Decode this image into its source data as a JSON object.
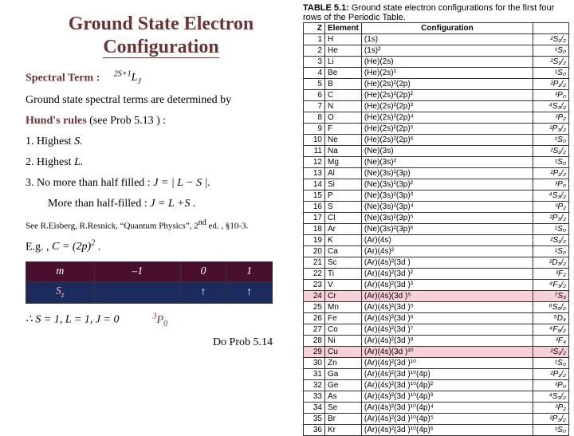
{
  "title_l1": "Ground State Electron",
  "title_l2": "Configuration",
  "spectral_label": "Spectral Term :",
  "spectral_formula_sup": "2S+1",
  "spectral_formula_base": "L",
  "spectral_formula_sub": "J",
  "gs_line": "Ground state spectral terms are determined by",
  "hund": "Hund's rules",
  "hund_after": "  (see Prob 5.13 ) :",
  "r1": "1.   Highest ",
  "r1i": "S.",
  "r2": "2.   Highest ",
  "r2i": "L.",
  "r3": "3.   No more than half filled : ",
  "r3f": "J = |  L  − S  |.",
  "r3b": "More than half-filled :  ",
  "r3bf": "J =   L +S .",
  "ref": "See R.Eisberg, R.Resnick, “Quantum Physics”, 2",
  "ref_nd": "nd",
  "ref_after": " ed. , §10-3.",
  "eg": "E.g. ,  ",
  "egf": "C = (2p)",
  "eg_sup": "2",
  "eg_dot": " .",
  "etbl": {
    "h": [
      "m",
      "–1",
      "0",
      "1"
    ],
    "rlabel": "S",
    "rsub": "z",
    "c": [
      "",
      "↑",
      "↑"
    ]
  },
  "concl": "∴  S = 1,  L = 1, J = 0",
  "term3p0_sup": "3",
  "term3p0_base": "P",
  "term3p0_sub": "0",
  "doprob": "Do Prob 5.14",
  "caption_pre": "TABLE 5.1: ",
  "caption": "Ground state electron configurations for the first four rows of the Periodic Table.",
  "ptbl": {
    "head": [
      "Z",
      "Element",
      "Configuration",
      ""
    ],
    "rows": [
      {
        "z": "1",
        "el": "H",
        "cfg": "(1s)",
        "term": "²S₁/₂"
      },
      {
        "z": "2",
        "el": "He",
        "cfg": "(1s)²",
        "term": "¹S₀"
      },
      {
        "z": "3",
        "el": "Li",
        "cfg": "(He)(2s)",
        "term": "²S₁/₂"
      },
      {
        "z": "4",
        "el": "Be",
        "cfg": "(He)(2s)²",
        "term": "¹S₀"
      },
      {
        "z": "5",
        "el": "B",
        "cfg": "(He)(2s)²(2p)",
        "term": "²P₁/₂"
      },
      {
        "z": "6",
        "el": "C",
        "cfg": "(He)(2s)²(2p)²",
        "term": "³P₀"
      },
      {
        "z": "7",
        "el": "N",
        "cfg": "(He)(2s)²(2p)³",
        "term": "⁴S₃/₂"
      },
      {
        "z": "8",
        "el": "O",
        "cfg": "(He)(2s)²(2p)⁴",
        "term": "³P₂"
      },
      {
        "z": "9",
        "el": "F",
        "cfg": "(He)(2s)²(2p)⁵",
        "term": "²P₃/₂"
      },
      {
        "z": "10",
        "el": "Ne",
        "cfg": "(He)(2s)²(2p)⁶",
        "term": "¹S₀"
      },
      {
        "z": "11",
        "el": "Na",
        "cfg": "(Ne)(3s)",
        "term": "²S₁/₂"
      },
      {
        "z": "12",
        "el": "Mg",
        "cfg": "(Ne)(3s)²",
        "term": "¹S₀"
      },
      {
        "z": "13",
        "el": "Al",
        "cfg": "(Ne)(3s)²(3p)",
        "term": "²P₁/₂"
      },
      {
        "z": "14",
        "el": "Si",
        "cfg": "(Ne)(3s)²(3p)²",
        "term": "³P₀"
      },
      {
        "z": "15",
        "el": "P",
        "cfg": "(Ne)(3s)²(3p)³",
        "term": "⁴S₃/₂"
      },
      {
        "z": "16",
        "el": "S",
        "cfg": "(Ne)(3s)²(3p)⁴",
        "term": "³P₂"
      },
      {
        "z": "17",
        "el": "Cl",
        "cfg": "(Ne)(3s)²(3p)⁵",
        "term": "²P₃/₂"
      },
      {
        "z": "18",
        "el": "Ar",
        "cfg": "(Ne)(3s)²(3p)⁶",
        "term": "¹S₀"
      },
      {
        "z": "19",
        "el": "K",
        "cfg": "(Ar)(4s)",
        "term": "²S₁/₂"
      },
      {
        "z": "20",
        "el": "Ca",
        "cfg": "(Ar)(4s)²",
        "term": "¹S₀"
      },
      {
        "z": "21",
        "el": "Sc",
        "cfg": "(Ar)(4s)²(3d  )",
        "term": "²D₃/₂"
      },
      {
        "z": "22",
        "el": "Ti",
        "cfg": "(Ar)(4s)²(3d  )²",
        "term": "³F₂"
      },
      {
        "z": "23",
        "el": "V",
        "cfg": "(Ar)(4s)²(3d  )³",
        "term": "⁴F₃/₂"
      },
      {
        "z": "24",
        "el": "Cr",
        "cfg": "(Ar)(4s)(3d  )⁵",
        "term": "⁷S₃",
        "hl": true
      },
      {
        "z": "25",
        "el": "Mn",
        "cfg": "(Ar)(4s)²(3d  )⁵",
        "term": "⁶S₅/₂"
      },
      {
        "z": "26",
        "el": "Fe",
        "cfg": "(Ar)(4s)²(3d  )⁶",
        "term": "⁵D₄"
      },
      {
        "z": "27",
        "el": "Co",
        "cfg": "(Ar)(4s)²(3d  )⁷",
        "term": "⁴F₉/₂"
      },
      {
        "z": "28",
        "el": "Ni",
        "cfg": "(Ar)(4s)²(3d  )⁸",
        "term": "³F₄"
      },
      {
        "z": "29",
        "el": "Cu",
        "cfg": "(Ar)(4s)(3d  )¹⁰",
        "term": "²S₁/₂",
        "hl": true
      },
      {
        "z": "30",
        "el": "Zn",
        "cfg": "(Ar)(4s)²(3d  )¹⁰",
        "term": "¹S₀"
      },
      {
        "z": "31",
        "el": "Ga",
        "cfg": "(Ar)(4s)²(3d  )¹⁰(4p)",
        "term": "²P₁/₂"
      },
      {
        "z": "32",
        "el": "Ge",
        "cfg": "(Ar)(4s)²(3d  )¹⁰(4p)²",
        "term": "³P₀"
      },
      {
        "z": "33",
        "el": "As",
        "cfg": "(Ar)(4s)²(3d  )¹⁰(4p)³",
        "term": "⁴S₃/₂"
      },
      {
        "z": "34",
        "el": "Se",
        "cfg": "(Ar)(4s)²(3d  )¹⁰(4p)⁴",
        "term": "³P₂"
      },
      {
        "z": "35",
        "el": "Br",
        "cfg": "(Ar)(4s)²(3d  )¹⁰(4p)⁵",
        "term": "²P₃/₂"
      },
      {
        "z": "36",
        "el": "Kr",
        "cfg": "(Ar)(4s)²(3d  )¹⁰(4p)⁶",
        "term": "¹S₀"
      }
    ]
  }
}
